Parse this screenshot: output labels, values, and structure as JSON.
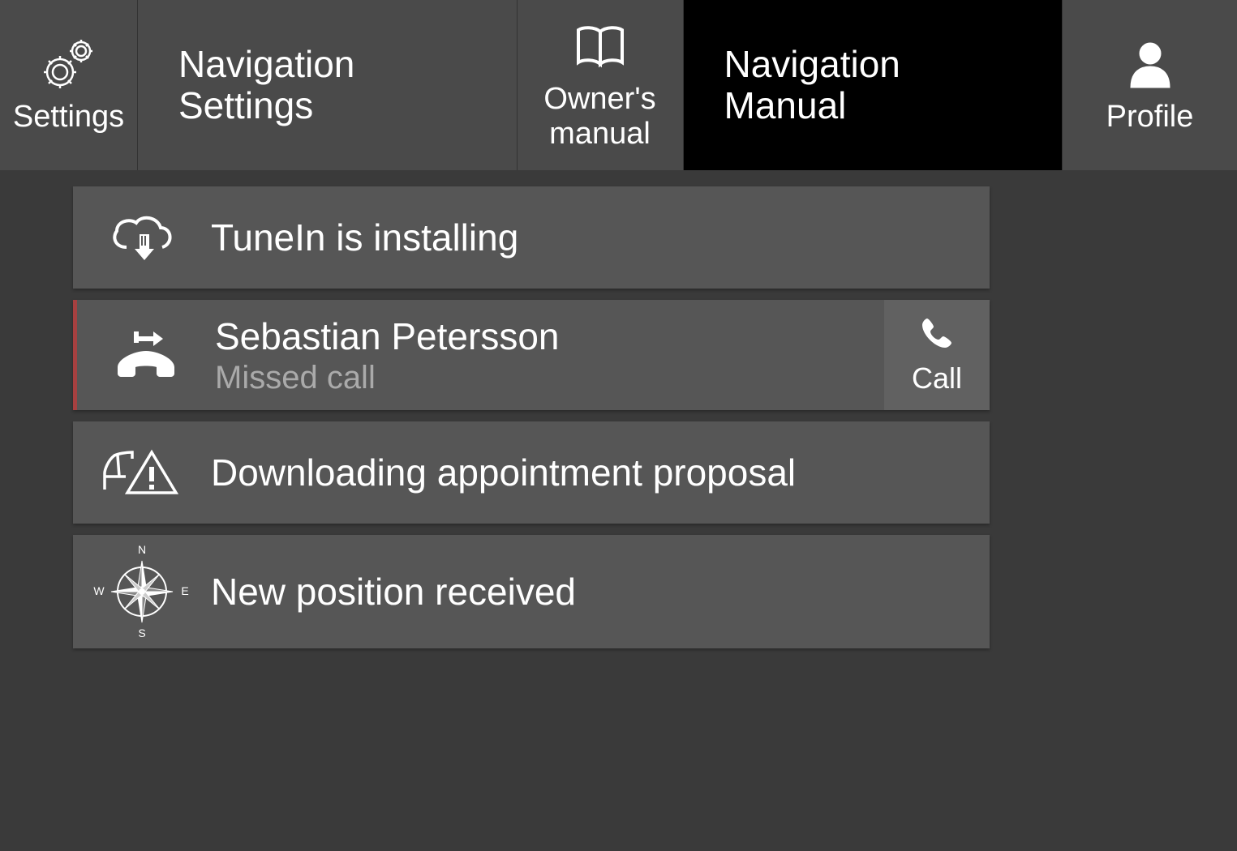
{
  "topbar": {
    "settings": "Settings",
    "navSettings": "Navigation\nSettings",
    "owners": "Owner's\nmanual",
    "navManual": "Navigation\nManual",
    "profile": "Profile"
  },
  "rows": {
    "install": {
      "title": "TuneIn is installing"
    },
    "missedCall": {
      "name": "Sebastian Petersson",
      "status": "Missed call",
      "action": "Call"
    },
    "appointment": {
      "title": "Downloading appointment proposal"
    },
    "position": {
      "title": "New position received",
      "compass": {
        "n": "N",
        "s": "S",
        "e": "E",
        "w": "W"
      }
    }
  }
}
